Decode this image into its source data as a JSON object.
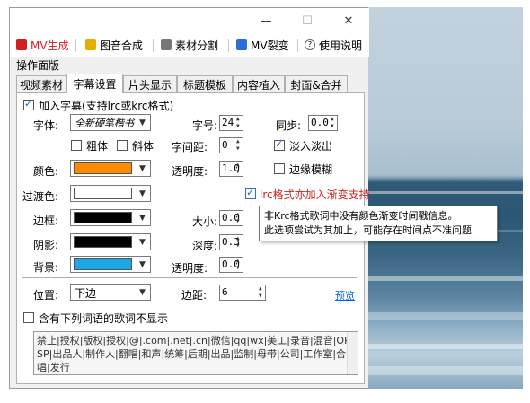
{
  "toolbar": {
    "items": [
      {
        "label": "MV生成",
        "icon": "film-icon",
        "color": "#d02020"
      },
      {
        "label": "图音合成",
        "icon": "image-music-icon",
        "color": "#000000"
      },
      {
        "label": "素材分割",
        "icon": "split-icon",
        "color": "#000000"
      },
      {
        "label": "MV裂变",
        "icon": "copy-icon",
        "color": "#000000"
      },
      {
        "label": "使用说明",
        "icon": "help-icon",
        "color": "#000000"
      }
    ]
  },
  "window": {
    "minimize": "—",
    "maximize": "☐",
    "close": "✕"
  },
  "panel_title": "操作面版",
  "tabs": [
    "视频素材",
    "字幕设置",
    "片头显示",
    "标题模板",
    "内容植入",
    "封面&合并"
  ],
  "subtitle": {
    "enable_label": "加入字幕(支持lrc或krc格式)",
    "font_label": "字体:",
    "font_value": "全新硬笔楷书",
    "size_label": "字号:",
    "size_value": "24",
    "sync_label": "同步:",
    "sync_value": "0.0",
    "bold_label": "粗体",
    "italic_label": "斜体",
    "spacing_label": "字间距:",
    "spacing_value": "0",
    "fade_label": "淡入淡出",
    "color_label": "颜色:",
    "color_value": "#ff8a00",
    "opacity_label": "透明度:",
    "opacity_value": "1.0",
    "blur_label": "边缘模糊",
    "transition_label": "过渡色:",
    "transition_color": "#ffffff",
    "lrc_gradient_label": "lrc格式亦加入渐变支持",
    "border_label": "边框:",
    "border_color": "#000000",
    "border_size_label": "大小:",
    "border_size_value": "0.0",
    "shadow_label": "阴影:",
    "shadow_color": "#000000",
    "depth_label": "深度:",
    "depth_value": "0.3",
    "bg_label": "背景:",
    "bg_color": "#1ea7e8",
    "bg_opacity_label": "透明度:",
    "bg_opacity_value": "0.0",
    "position_label": "位置:",
    "position_value": "下边",
    "margin_label": "边距:",
    "margin_value": "6",
    "preview_link": "预览",
    "exclude_label": "含有下列词语的歌词不显示",
    "exclude_words": "禁止|授权|版权|授权|@|.com|.net|.cn|微信|qq|wx|美工|录音|混音|OP|SP|出品人|制作人|翻唱|和声|统筹|后期|出品|监制|母带|公司|工作室|合唱|发行"
  },
  "tooltip": {
    "line1": "非Krc格式歌词中没有颜色渐变时间戳信息。",
    "line2": "此选项尝试为其加上，可能存在时间点不准问题"
  }
}
